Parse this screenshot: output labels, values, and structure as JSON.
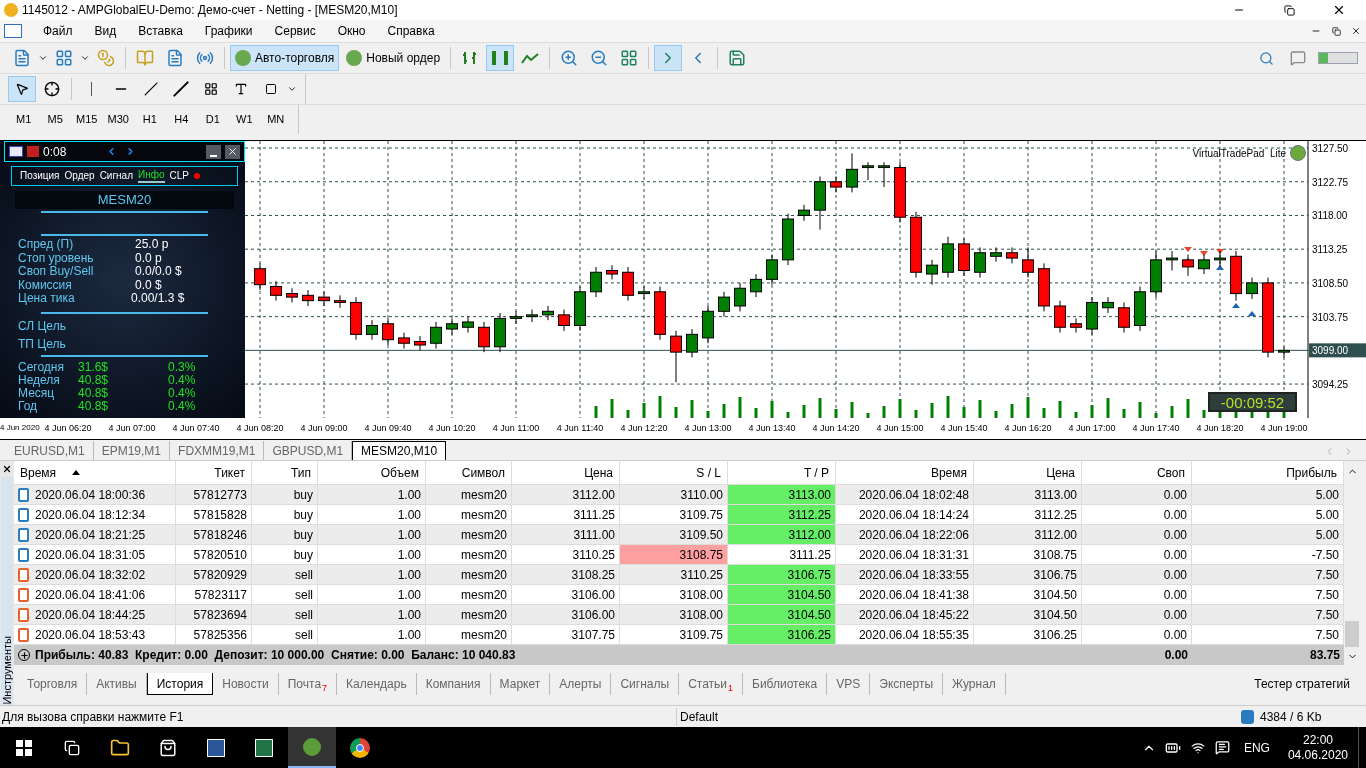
{
  "window": {
    "title": "1145012 - AMPGlobalEU-Demo: Демо-счет - Netting - [MESM20,M10]"
  },
  "menu": [
    "Файл",
    "Вид",
    "Вставка",
    "Графики",
    "Сервис",
    "Окно",
    "Справка"
  ],
  "toolbar": {
    "buttons": [
      {
        "label": "Авто-торговля",
        "pressed": true
      },
      {
        "label": "Новый ордер",
        "pressed": false
      }
    ]
  },
  "timeframes": [
    "M1",
    "M5",
    "M15",
    "M30",
    "H1",
    "H4",
    "D1",
    "W1",
    "MN"
  ],
  "trade_panel": {
    "timer": "0:08",
    "tabs": [
      {
        "label": "Позиция",
        "selected": false
      },
      {
        "label": "Ордер",
        "selected": false
      },
      {
        "label": "Сигнал",
        "selected": false
      },
      {
        "label": "Инфо",
        "selected": true
      },
      {
        "label": "CLP",
        "selected": false
      }
    ],
    "symbol": "MESM20",
    "stats": [
      {
        "label": "Спред (П)",
        "value": "25.0 p"
      },
      {
        "label": "Стоп уровень",
        "value": "0.0 p"
      },
      {
        "label": "Своп Buy/Sell",
        "value": "0.0/0.0 $"
      },
      {
        "label": "Комиссия",
        "value": "0.0 $"
      },
      {
        "label": "Цена тика",
        "value": "0.00/1.3 $"
      }
    ],
    "targets": [
      "СЛ Цель",
      "ТП Цель"
    ],
    "performance": [
      {
        "label": "Сегодня",
        "amount": "31.6$",
        "percent": "0.3%"
      },
      {
        "label": "Неделя",
        "amount": "40.8$",
        "percent": "0.4%"
      },
      {
        "label": "Месяц",
        "amount": "40.8$",
        "percent": "0.4%"
      },
      {
        "label": "Год",
        "amount": "40.8$",
        "percent": "0.4%"
      }
    ]
  },
  "chart": {
    "overlay_label": "VirtualTradePad  Lite",
    "countdown": "-00:09:52",
    "chart_data": {
      "type": "candlestick",
      "grid": true,
      "ylim": [
        3089.33,
        3128.49
      ],
      "ref_lines": [
        {
          "axis": "y",
          "value": 3099,
          "label": "3099.00"
        }
      ],
      "categories": [
        "4 Jun 2020",
        null,
        null,
        null,
        "4 Jun 06:20",
        null,
        null,
        null,
        "4 Jun 07:00",
        null,
        null,
        null,
        "4 Jun 07:40",
        null,
        null,
        null,
        "4 Jun 08:20",
        null,
        null,
        null,
        "4 Jun 09:00",
        null,
        null,
        null,
        "4 Jun 09:40",
        null,
        null,
        null,
        "4 Jun 10:20",
        null,
        null,
        null,
        "4 Jun 11:00",
        null,
        null,
        null,
        "4 Jun 11:40",
        null,
        null,
        null,
        "4 Jun 12:20",
        null,
        null,
        null,
        "4 Jun 13:00",
        null,
        null,
        null,
        "4 Jun 13:40",
        null,
        null,
        null,
        "4 Jun 14:20",
        null,
        null,
        null,
        "4 Jun 15:00",
        null,
        null,
        null,
        "4 Jun 15:40",
        null,
        null,
        null,
        "4 Jun 16:20",
        null,
        null,
        null,
        "4 Jun 17:00",
        null,
        null,
        null,
        "4 Jun 17:40",
        null,
        null,
        null,
        "4 Jun 18:20",
        null,
        null,
        null,
        "4 Jun 19:00"
      ],
      "yticks": [
        {
          "value": 3127.5,
          "label": "3127.50"
        },
        {
          "value": 3122.75,
          "label": "3122.75"
        },
        {
          "value": 3118,
          "label": "3118.00"
        },
        {
          "value": 3113.25,
          "label": "3113.25"
        },
        {
          "value": 3108.5,
          "label": "3108.50"
        },
        {
          "value": 3103.75,
          "label": "3103.75"
        },
        {
          "value": 3094.25,
          "label": "3094.25"
        }
      ],
      "ohlc": [
        null,
        null,
        null,
        null,
        null,
        null,
        null,
        null,
        null,
        null,
        null,
        null,
        null,
        null,
        null,
        null,
        [
          3110.5,
          3111.25,
          3107.5,
          3108.25
        ],
        [
          3108,
          3108.75,
          3106,
          3106.75
        ],
        [
          3107,
          3107.75,
          3105.75,
          3106.5
        ],
        [
          3106.75,
          3107.5,
          3105.25,
          3106
        ],
        [
          3106.5,
          3107.25,
          3105.25,
          3106
        ],
        [
          3106,
          3106.75,
          3105,
          3105.75
        ],
        [
          3105.75,
          3106.5,
          3100.5,
          3101.25
        ],
        [
          3101.25,
          3103.25,
          3100.5,
          3102.5
        ],
        [
          3102.75,
          3103.5,
          3099.75,
          3100.5
        ],
        [
          3100.75,
          3101.5,
          3099.25,
          3100
        ],
        [
          3100.25,
          3101,
          3099,
          3099.75
        ],
        [
          3100,
          3103,
          3099.25,
          3102.25
        ],
        [
          3102,
          3103.5,
          3101.25,
          3102.75
        ],
        [
          3102.25,
          3103.75,
          3101.5,
          3103
        ],
        [
          3102.25,
          3103,
          3098.75,
          3099.5
        ],
        [
          3099.5,
          3104.25,
          3098.75,
          3103.5
        ],
        [
          3103.5,
          3104.5,
          3102.75,
          3103.75
        ],
        [
          3103.75,
          3104.75,
          3103,
          3104
        ],
        [
          3104,
          3105.25,
          3103.25,
          3104.5
        ],
        [
          3104,
          3104.75,
          3101.75,
          3102.5
        ],
        [
          3102.5,
          3108,
          3101.75,
          3107.25
        ],
        [
          3107.25,
          3110.75,
          3106.5,
          3110
        ],
        [
          3110.25,
          3111,
          3109,
          3109.75
        ],
        [
          3110,
          3110.75,
          3106,
          3106.75
        ],
        [
          3107,
          3108,
          3106.25,
          3107.25
        ],
        [
          3107.25,
          3108,
          3100.5,
          3101.25
        ],
        [
          3101,
          3101.75,
          3094.5,
          3098.75
        ],
        [
          3098.75,
          3102,
          3098,
          3101.25
        ],
        [
          3100.75,
          3105.25,
          3100,
          3104.5
        ],
        [
          3104.5,
          3107.25,
          3103.75,
          3106.5
        ],
        [
          3105.25,
          3108.5,
          3104.5,
          3107.75
        ],
        [
          3107.25,
          3109.75,
          3106.5,
          3109
        ],
        [
          3109,
          3112.5,
          3108.25,
          3111.75
        ],
        [
          3111.75,
          3118.25,
          3111,
          3117.5
        ],
        [
          3118,
          3119.5,
          3117.25,
          3118.75
        ],
        [
          3118.75,
          3123.5,
          3116,
          3122.75
        ],
        [
          3122.75,
          3123.5,
          3121.25,
          3122
        ],
        [
          3122,
          3126.75,
          3121.25,
          3124.5
        ],
        [
          3124.75,
          3125.5,
          3123,
          3125
        ],
        [
          3124.75,
          3125.5,
          3122,
          3125
        ],
        [
          3124.75,
          3125.5,
          3117,
          3117.75
        ],
        [
          3117.75,
          3118.5,
          3109.25,
          3110
        ],
        [
          3109.75,
          3111.75,
          3108.25,
          3111
        ],
        [
          3110,
          3115,
          3109.25,
          3114
        ],
        [
          3114,
          3114.75,
          3109.5,
          3110.25
        ],
        [
          3110,
          3113.5,
          3109.25,
          3112.75
        ],
        [
          3112.25,
          3113.5,
          3111.5,
          3112.75
        ],
        [
          3112.75,
          3113.5,
          3111.25,
          3112
        ],
        [
          3111.75,
          3113.5,
          3109.25,
          3110
        ],
        [
          3110.5,
          3111.25,
          3104.5,
          3105.25
        ],
        [
          3105.25,
          3106,
          3101.5,
          3102.25
        ],
        [
          3102.75,
          3103.5,
          3101.5,
          3102.25
        ],
        [
          3102,
          3106.5,
          3101.25,
          3105.75
        ],
        [
          3105,
          3106.5,
          3104.25,
          3105.75
        ],
        [
          3105,
          3105.75,
          3101.5,
          3102.25
        ],
        [
          3102.5,
          3108,
          3101.75,
          3107.25
        ],
        [
          3107.25,
          3113,
          3106.5,
          3111.75
        ],
        [
          3111.75,
          3113,
          3110.25,
          3112
        ],
        [
          3111.75,
          3112.5,
          3109.5,
          3110.75
        ],
        [
          3110.5,
          3112.5,
          3109.75,
          3111.75
        ],
        [
          3111.75,
          3113,
          3110.75,
          3112
        ],
        [
          3112.25,
          3113,
          3106,
          3107
        ],
        [
          3107,
          3109.25,
          3106.25,
          3108.5
        ],
        [
          3108.5,
          3109.25,
          3098,
          3098.75
        ],
        [
          3098.75,
          3099.5,
          3098,
          3099
        ]
      ]
    }
  },
  "chart_tabs": [
    {
      "label": "EURUSD,M1",
      "selected": false
    },
    {
      "label": "EPM19,M1",
      "selected": false
    },
    {
      "label": "FDXMM19,M1",
      "selected": false
    },
    {
      "label": "GBPUSD,M1",
      "selected": false
    },
    {
      "label": "MESM20,M10",
      "selected": true
    }
  ],
  "toolbox_label": "Инструменты",
  "history_table": {
    "columns": [
      "Время",
      "Тикет",
      "Тип",
      "Объем",
      "Символ",
      "Цена",
      "S / L",
      "T / P",
      "Время",
      "Цена",
      "Своп",
      "Прибыль"
    ],
    "rows": [
      {
        "kind": "buy",
        "sl_highlight": false,
        "tp_highlight": true,
        "cells": [
          "2020.06.04 18:00:36",
          "57812773",
          "buy",
          "1.00",
          "mesm20",
          "3112.00",
          "3110.00",
          "3113.00",
          "2020.06.04 18:02:48",
          "3113.00",
          "0.00",
          "5.00"
        ]
      },
      {
        "kind": "buy",
        "sl_highlight": false,
        "tp_highlight": true,
        "cells": [
          "2020.06.04 18:12:34",
          "57815828",
          "buy",
          "1.00",
          "mesm20",
          "3111.25",
          "3109.75",
          "3112.25",
          "2020.06.04 18:14:24",
          "3112.25",
          "0.00",
          "5.00"
        ]
      },
      {
        "kind": "buy",
        "sl_highlight": false,
        "tp_highlight": true,
        "cells": [
          "2020.06.04 18:21:25",
          "57818246",
          "buy",
          "1.00",
          "mesm20",
          "3111.00",
          "3109.50",
          "3112.00",
          "2020.06.04 18:22:06",
          "3112.00",
          "0.00",
          "5.00"
        ]
      },
      {
        "kind": "buy",
        "sl_highlight": true,
        "tp_highlight": false,
        "cells": [
          "2020.06.04 18:31:05",
          "57820510",
          "buy",
          "1.00",
          "mesm20",
          "3110.25",
          "3108.75",
          "3111.25",
          "2020.06.04 18:31:31",
          "3108.75",
          "0.00",
          "-7.50"
        ]
      },
      {
        "kind": "sell",
        "sl_highlight": false,
        "tp_highlight": true,
        "cells": [
          "2020.06.04 18:32:02",
          "57820929",
          "sell",
          "1.00",
          "mesm20",
          "3108.25",
          "3110.25",
          "3106.75",
          "2020.06.04 18:33:55",
          "3106.75",
          "0.00",
          "7.50"
        ]
      },
      {
        "kind": "sell",
        "sl_highlight": false,
        "tp_highlight": true,
        "cells": [
          "2020.06.04 18:41:06",
          "57823117",
          "sell",
          "1.00",
          "mesm20",
          "3106.00",
          "3108.00",
          "3104.50",
          "2020.06.04 18:41:38",
          "3104.50",
          "0.00",
          "7.50"
        ]
      },
      {
        "kind": "sell",
        "sl_highlight": false,
        "tp_highlight": true,
        "cells": [
          "2020.06.04 18:44:25",
          "57823694",
          "sell",
          "1.00",
          "mesm20",
          "3106.00",
          "3108.00",
          "3104.50",
          "2020.06.04 18:45:22",
          "3104.50",
          "0.00",
          "7.50"
        ]
      },
      {
        "kind": "sell",
        "sl_highlight": false,
        "tp_highlight": true,
        "cells": [
          "2020.06.04 18:53:43",
          "57825356",
          "sell",
          "1.00",
          "mesm20",
          "3107.75",
          "3109.75",
          "3106.25",
          "2020.06.04 18:55:35",
          "3106.25",
          "0.00",
          "7.50"
        ]
      }
    ],
    "summary": {
      "text": "Прибыль: 40.83  Кредит: 0.00  Депозит: 10 000.00  Снятие: 0.00  Баланс: 10 040.83",
      "swap": "0.00",
      "profit": "83.75"
    }
  },
  "bottom_tabs": [
    {
      "label": "Торговля",
      "selected": false
    },
    {
      "label": "Активы",
      "selected": false
    },
    {
      "label": "История",
      "selected": true
    },
    {
      "label": "Новости",
      "selected": false
    },
    {
      "label": "Почта",
      "selected": false,
      "badge": "7"
    },
    {
      "label": "Календарь",
      "selected": false
    },
    {
      "label": "Компания",
      "selected": false
    },
    {
      "label": "Маркет",
      "selected": false
    },
    {
      "label": "Алерты",
      "selected": false
    },
    {
      "label": "Сигналы",
      "selected": false
    },
    {
      "label": "Статьи",
      "selected": false,
      "badge": "1"
    },
    {
      "label": "Библиотека",
      "selected": false
    },
    {
      "label": "VPS",
      "selected": false
    },
    {
      "label": "Эксперты",
      "selected": false
    },
    {
      "label": "Журнал",
      "selected": false
    }
  ],
  "strategy_tester": "Тестер стратегий",
  "status_bar": {
    "help": "Для вызова справки нажмите F1",
    "profile": "Default",
    "traffic": "4384 / 6 Kb"
  },
  "taskbar": {
    "language": "ENG",
    "time": "22:00",
    "date": "04.06.2020"
  }
}
